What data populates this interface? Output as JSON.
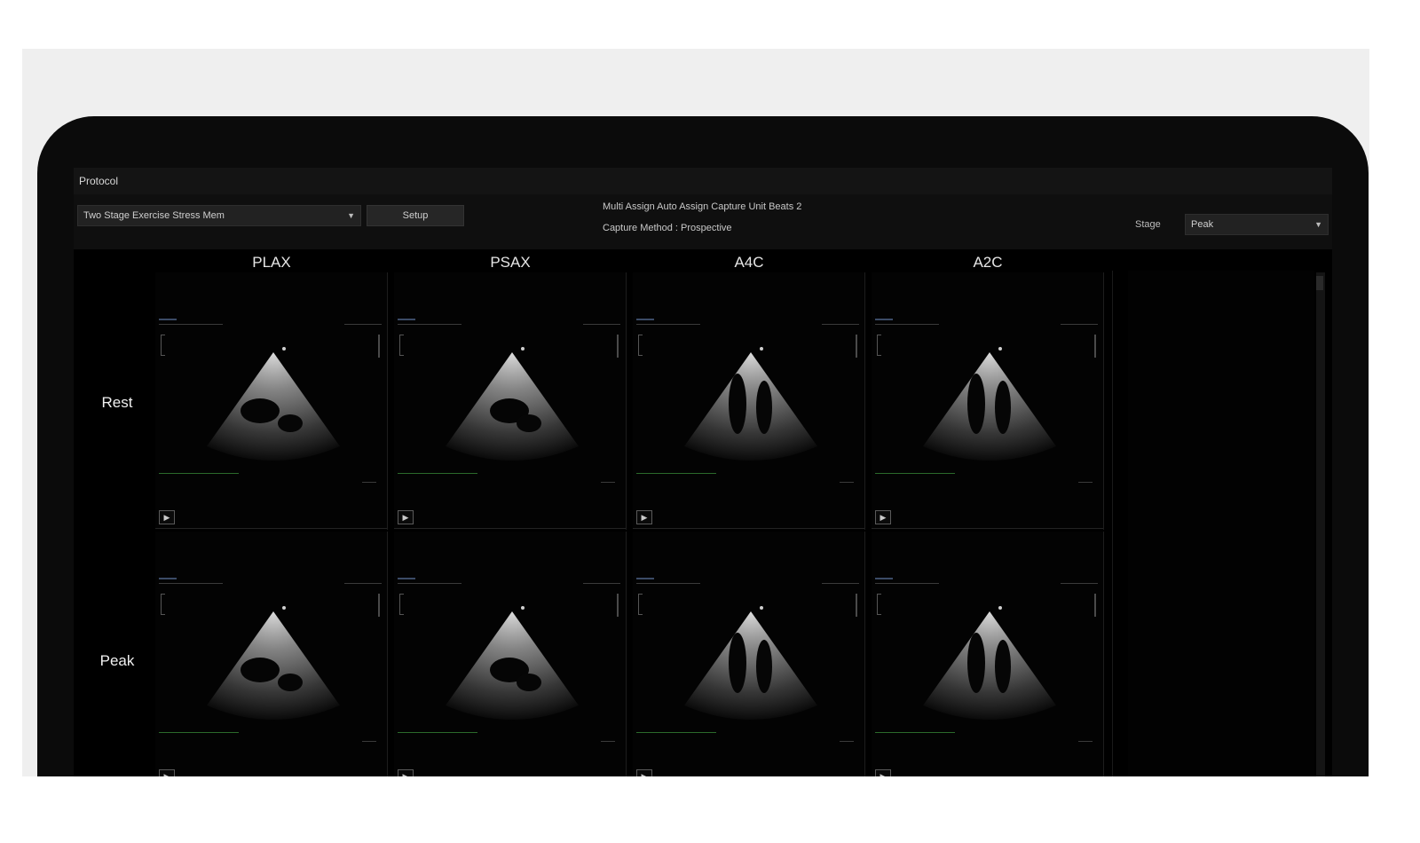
{
  "protocol_bar": {
    "title": "Protocol"
  },
  "controls": {
    "protocol_select_value": "Two Stage Exercise Stress Mem",
    "setup_label": "Setup",
    "info_line1": "Multi Assign Auto Assign Capture Unit Beats 2",
    "info_line2": "Capture Method : Prospective",
    "stage_label": "Stage",
    "stage_select_value": "Peak"
  },
  "grid": {
    "columns": [
      "PLAX",
      "PSAX",
      "A4C",
      "A2C"
    ],
    "rows": [
      "Rest",
      "Peak"
    ]
  },
  "icons": {
    "dropdown": "chevron-down-icon",
    "play": "play-icon"
  },
  "colors": {
    "screen_bg": "#000000",
    "ecg_trace": "#2b6a2b",
    "bezel": "#0b0b0b"
  }
}
